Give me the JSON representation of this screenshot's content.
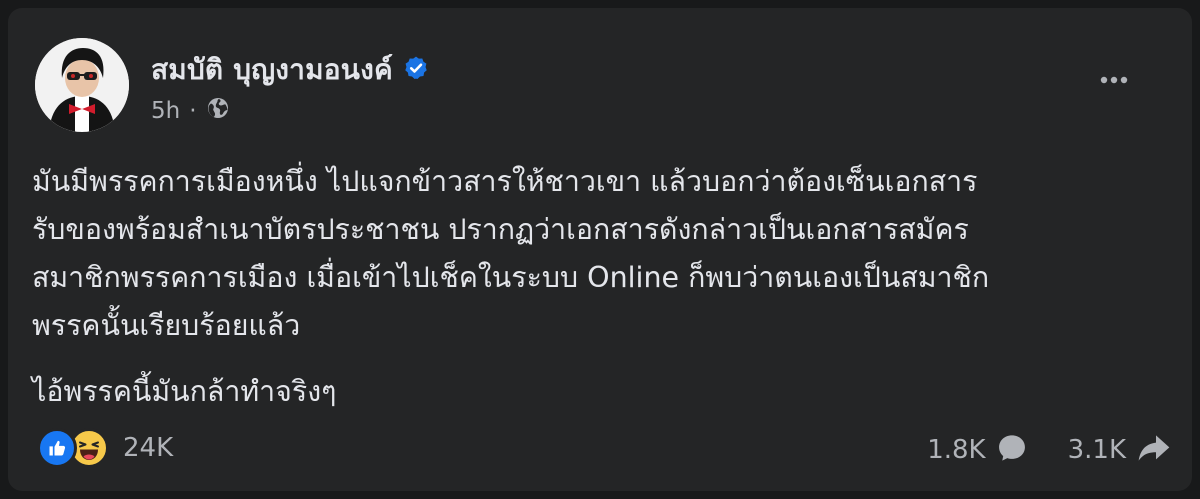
{
  "post": {
    "author": "สมบัติ บุญงามอนงค์",
    "verified": true,
    "time": "5h",
    "separator": "·",
    "audience_icon": "globe-icon",
    "more_icon": "more-options-icon",
    "paragraphs": [
      "มันมีพรรคการเมืองหนึ่ง ไปแจกข้าวสารให้ชาวเขา แล้วบอกว่าต้องเซ็นเอกสาร",
      "รับของพร้อมสำเนาบัตรประชาชน ปรากฏว่าเอกสารดังกล่าวเป็นเอกสารสมัคร",
      "สมาชิกพรรคการเมือง เมื่อเข้าไปเช็คในระบบ Online ก็พบว่าตนเองเป็นสมาชิก",
      "พรรคนั้นเรียบร้อยแล้ว"
    ],
    "closing": "ไอ้พรรคนี้มันกล้าทำจริงๆ"
  },
  "stats": {
    "reactions": [
      "like-icon",
      "haha-icon"
    ],
    "reaction_count": "24K",
    "comments": "1.8K",
    "shares": "3.1K"
  },
  "colors": {
    "background": "#18191a",
    "card": "#242526",
    "text_primary": "#e4e6eb",
    "text_secondary": "#b0b3b8",
    "verified_blue": "#1b74e4",
    "like_blue": "#1877f2",
    "haha_yellow": "#f7c94a"
  }
}
